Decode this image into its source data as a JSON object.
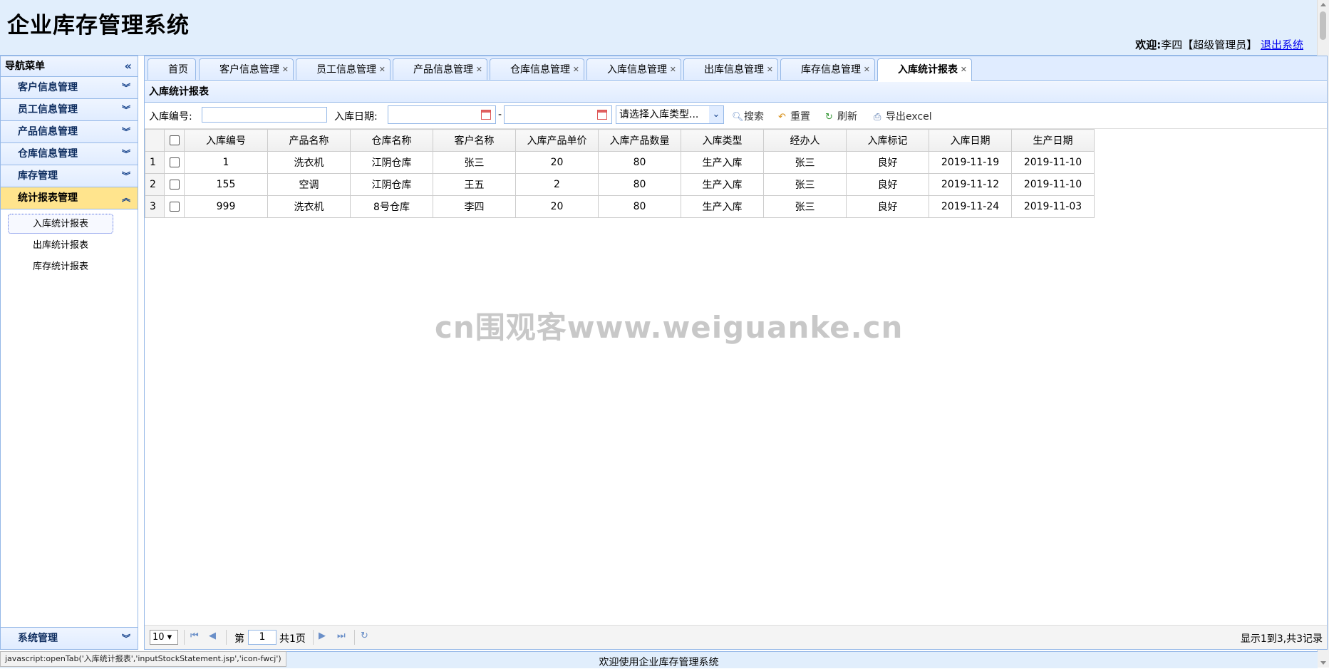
{
  "header": {
    "title": "企业库存管理系统",
    "welcome_label": "欢迎:",
    "user": "李四【超级管理员】",
    "logout": "退出系统"
  },
  "sidebar": {
    "title": "导航菜单",
    "items": [
      {
        "label": "客户信息管理"
      },
      {
        "label": "员工信息管理"
      },
      {
        "label": "产品信息管理"
      },
      {
        "label": "仓库信息管理"
      },
      {
        "label": "库存管理"
      },
      {
        "label": "统计报表管理"
      }
    ],
    "subitems": [
      {
        "label": "入库统计报表"
      },
      {
        "label": "出库统计报表"
      },
      {
        "label": "库存统计报表"
      }
    ],
    "bottom": {
      "label": "系统管理"
    }
  },
  "tabs": [
    {
      "label": "首页"
    },
    {
      "label": "客户信息管理"
    },
    {
      "label": "员工信息管理"
    },
    {
      "label": "产品信息管理"
    },
    {
      "label": "仓库信息管理"
    },
    {
      "label": "入库信息管理"
    },
    {
      "label": "出库信息管理"
    },
    {
      "label": "库存信息管理"
    },
    {
      "label": "入库统计报表"
    }
  ],
  "panel": {
    "title": "入库统计报表"
  },
  "toolbar": {
    "id_label": "入库编号:",
    "id_value": "",
    "date_label": "入库日期:",
    "date_sep": "-",
    "type_placeholder": "请选择入库类型...",
    "search": "搜索",
    "reset": "重置",
    "refresh": "刷新",
    "export": "导出excel"
  },
  "grid": {
    "columns": [
      "入库编号",
      "产品名称",
      "仓库名称",
      "客户名称",
      "入库产品单价",
      "入库产品数量",
      "入库类型",
      "经办人",
      "入库标记",
      "入库日期",
      "生产日期"
    ],
    "rows": [
      {
        "rn": "1",
        "cells": [
          "1",
          "洗衣机",
          "江阴仓库",
          "张三",
          "20",
          "80",
          "生产入库",
          "张三",
          "良好",
          "2019-11-19",
          "2019-11-10"
        ]
      },
      {
        "rn": "2",
        "cells": [
          "155",
          "空调",
          "江阴仓库",
          "王五",
          "2",
          "80",
          "生产入库",
          "张三",
          "良好",
          "2019-11-12",
          "2019-11-10"
        ]
      },
      {
        "rn": "3",
        "cells": [
          "999",
          "洗衣机",
          "8号仓库",
          "李四",
          "20",
          "80",
          "生产入库",
          "张三",
          "良好",
          "2019-11-24",
          "2019-11-03"
        ]
      }
    ]
  },
  "pager": {
    "page_size": "10",
    "page_prefix": "第",
    "page_number": "1",
    "page_total": "共1页",
    "summary": "显示1到3,共3记录"
  },
  "watermark": "cn围观客www.weiguanke.cn",
  "status": {
    "message": "欢迎使用企业库存管理系统",
    "link_url": "javascript:openTab('入库统计报表','inputStockStatement.jsp','icon-fwcj')"
  }
}
